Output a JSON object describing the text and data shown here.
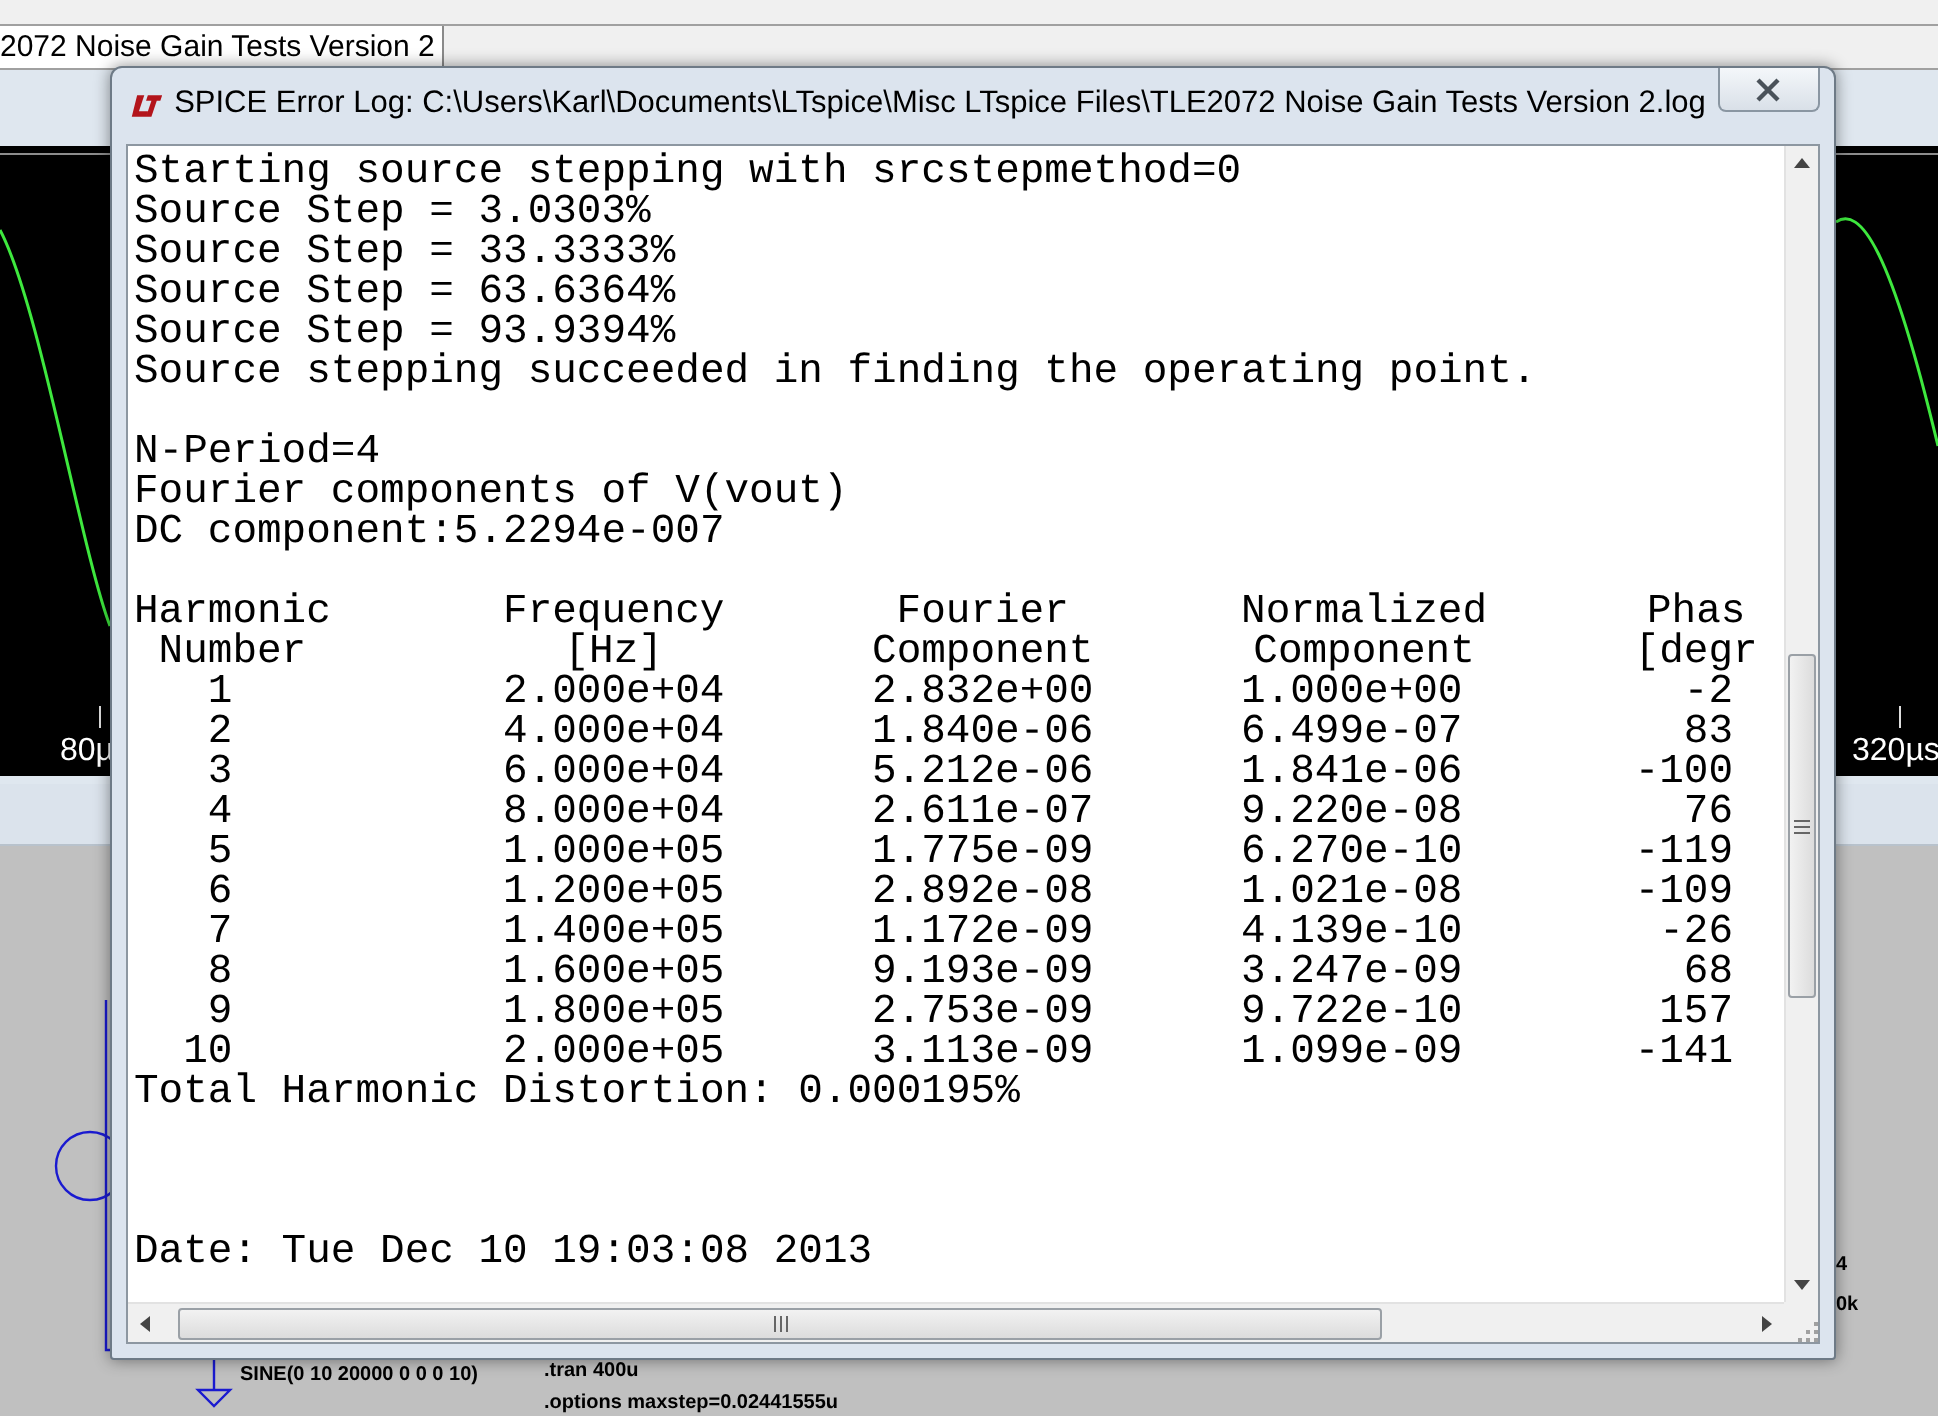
{
  "background_window": {
    "tab": "2072 Noise Gain Tests Version 2",
    "plot": {
      "left_axis_label": "80µ",
      "right_axis_label": "320µs"
    },
    "schematic": {
      "source_label": "SINE(0 10 20000 0 0 0 10)",
      "directives": [
        ".tran 400u",
        ".options maxstep=0.02441555u"
      ],
      "edge_labels": [
        "4",
        "0k"
      ]
    }
  },
  "dialog": {
    "title": "SPICE Error Log: C:\\Users\\Karl\\Documents\\LTspice\\Misc LTspice Files\\TLE2072 Noise Gain Tests Version 2.log",
    "paragraphs": [
      [
        "Starting source stepping with srcstepmethod=0",
        "Source Step = 3.0303%",
        "Source Step = 33.3333%",
        "Source Step = 63.6364%",
        "Source Step = 93.9394%",
        "Source stepping succeeded in finding the operating point."
      ],
      [
        "N-Period=4",
        "Fourier components of V(vout)",
        "DC component:5.2294e-007"
      ]
    ],
    "harmonics_table": {
      "header_rows": [
        [
          "Harmonic",
          "Frequency",
          "Fourier",
          "Normalized",
          "Phas"
        ],
        [
          "Number",
          "[Hz]",
          "Component",
          "Component",
          "[degr"
        ]
      ],
      "rows": [
        [
          "1",
          "2.000e+04",
          "2.832e+00",
          "1.000e+00",
          "-2"
        ],
        [
          "2",
          "4.000e+04",
          "1.840e-06",
          "6.499e-07",
          "83"
        ],
        [
          "3",
          "6.000e+04",
          "5.212e-06",
          "1.841e-06",
          "-100"
        ],
        [
          "4",
          "8.000e+04",
          "2.611e-07",
          "9.220e-08",
          "76"
        ],
        [
          "5",
          "1.000e+05",
          "1.775e-09",
          "6.270e-10",
          "-119"
        ],
        [
          "6",
          "1.200e+05",
          "2.892e-08",
          "1.021e-08",
          "-109"
        ],
        [
          "7",
          "1.400e+05",
          "1.172e-09",
          "4.139e-10",
          "-26"
        ],
        [
          "8",
          "1.600e+05",
          "9.193e-09",
          "3.247e-09",
          "68"
        ],
        [
          "9",
          "1.800e+05",
          "2.753e-09",
          "9.722e-10",
          "157"
        ],
        [
          "10",
          "2.000e+05",
          "3.113e-09",
          "1.099e-09",
          "-141"
        ]
      ]
    },
    "summary": "Total Harmonic Distortion: 0.000195%",
    "date": "Date: Tue Dec 10 19:03:08 2013"
  }
}
